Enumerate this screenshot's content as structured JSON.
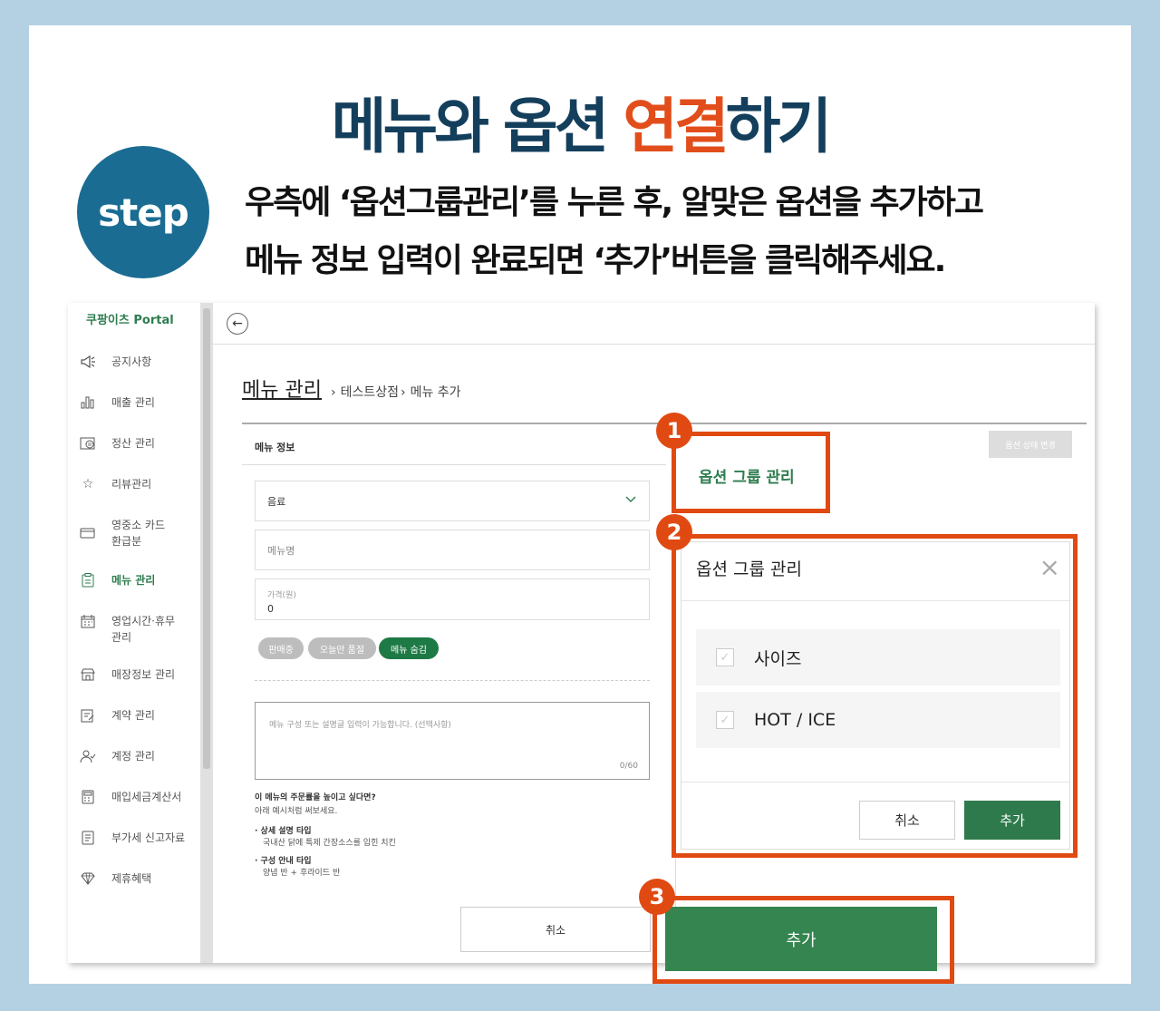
{
  "title": {
    "part1": "메뉴와 옵션 ",
    "accent": "연결",
    "part2": "하기"
  },
  "step_badge": "step",
  "instruction": {
    "line1": "우측에 ‘옵션그룹관리’를 누른 후, 알맞은 옵션을 추가하고",
    "line2": "메뉴 정보 입력이 완료되면 ‘추가’버튼을 클릭해주세요."
  },
  "sidebar": {
    "logo": "쿠팡이츠 Portal",
    "items": [
      {
        "label": "공지사항",
        "icon": "megaphone-icon"
      },
      {
        "label": "매출 관리",
        "icon": "bar-chart-icon"
      },
      {
        "label": "정산 관리",
        "icon": "won-card-icon"
      },
      {
        "label": "리뷰관리",
        "icon": "star-review-icon"
      },
      {
        "label": "영중소 카드 환급분",
        "icon": "card-refund-icon"
      },
      {
        "label": "메뉴 관리",
        "icon": "menu-clipboard-icon",
        "active": true
      },
      {
        "label": "영업시간·휴무 관리",
        "icon": "calendar-icon"
      },
      {
        "label": "매장정보 관리",
        "icon": "store-icon"
      },
      {
        "label": "계약 관리",
        "icon": "contract-icon"
      },
      {
        "label": "계정 관리",
        "icon": "user-check-icon"
      },
      {
        "label": "매입세금계산서",
        "icon": "calculator-icon"
      },
      {
        "label": "부가세 신고자료",
        "icon": "document-icon"
      },
      {
        "label": "제휴혜택",
        "icon": "diamond-icon"
      }
    ]
  },
  "breadcrumb": {
    "root": "메뉴 관리",
    "store": "테스트상점",
    "current": "메뉴 추가",
    "sep": "›"
  },
  "menu_info": {
    "section_title": "메뉴 정보",
    "category_value": "음료",
    "name_placeholder": "메뉴명",
    "price_label": "가격(원)",
    "price_value": "0",
    "chips": [
      "판매중",
      "오늘만 품절",
      "메뉴 숨김"
    ],
    "description_placeholder": "메뉴 구성 또는 설명글 입력이 가능합니다. (선택사항)",
    "char_count": "0/60",
    "tip_title": "이 메뉴의 주문률을 높이고 싶다면?",
    "tip_sub": "아래 예시처럼 써보세요.",
    "tip1_title": "· 상세 설명 타입",
    "tip1_body": "국내산 닭에 특제 간장소스를 입힌 치킨",
    "tip2_title": "· 구성 안내 타입",
    "tip2_body": "양념 반 + 후라이드 반",
    "cancel_label": "취소"
  },
  "option_status_button": "옵션 상태 변경",
  "option_group_button": "옵션 그룹 관리",
  "modal": {
    "title": "옵션 그룹 관리",
    "options": [
      "사이즈",
      "HOT / ICE"
    ],
    "cancel_label": "취소",
    "add_label": "추가"
  },
  "add_button": "추가",
  "markers": [
    "1",
    "2",
    "3"
  ],
  "colors": {
    "accent": "#e24e1b",
    "navy": "#143f5c",
    "green": "#2e7d4f",
    "marker": "#e04a12"
  }
}
